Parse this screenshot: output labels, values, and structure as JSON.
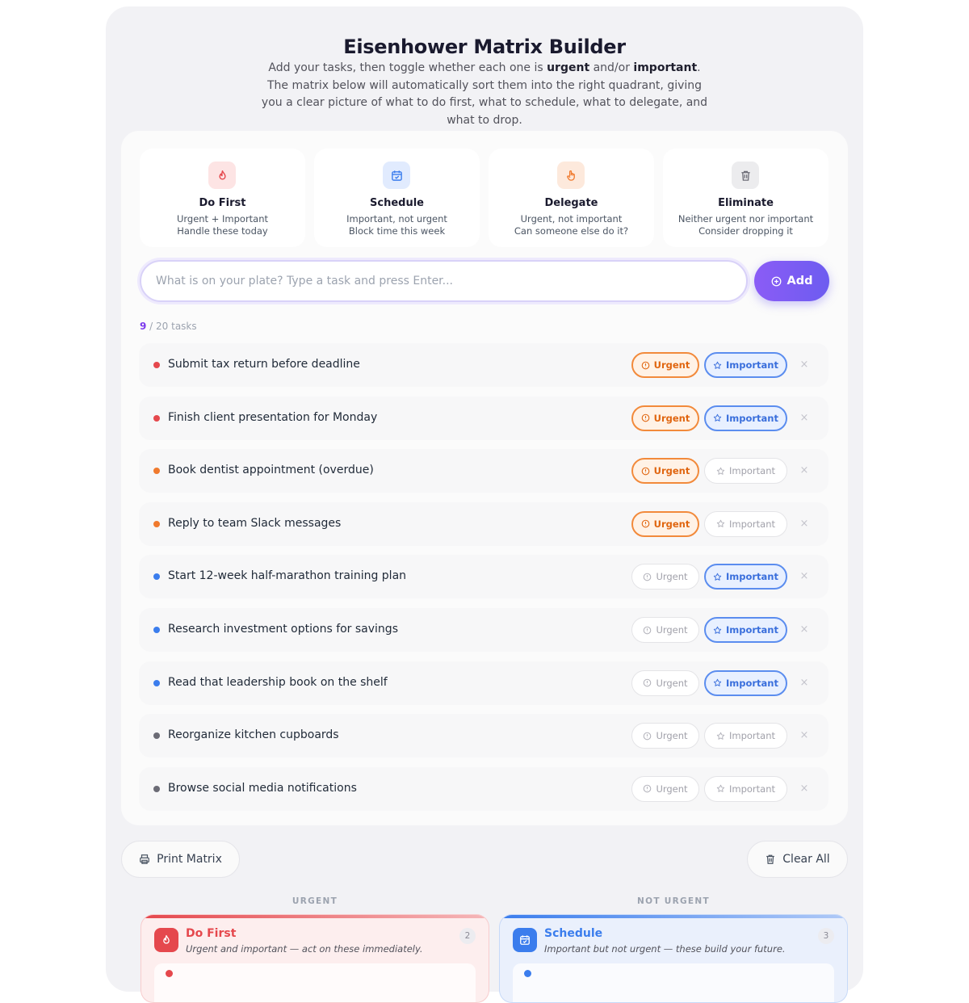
{
  "header": {
    "title": "Eisenhower Matrix Builder",
    "subtitle_part1": "Add your tasks, then toggle whether each one is ",
    "subtitle_urgent": "urgent",
    "subtitle_part2": " and/or ",
    "subtitle_important": "important",
    "subtitle_part3": ". The matrix below will automatically sort them into the right quadrant, giving you a clear picture of what to do first, what to schedule, what to delegate, and what to drop."
  },
  "legend": [
    {
      "name": "Do First",
      "line1": "Urgent + Important",
      "line2": "Handle these today",
      "icon": "flame-icon",
      "bg": "#fde4e4",
      "fg": "#e5484d"
    },
    {
      "name": "Schedule",
      "line1": "Important, not urgent",
      "line2": "Block time this week",
      "icon": "calendar-icon",
      "bg": "#e1ebfe",
      "fg": "#3b7ded"
    },
    {
      "name": "Delegate",
      "line1": "Urgent, not important",
      "line2": "Can someone else do it?",
      "icon": "hand-icon",
      "bg": "#fde9dc",
      "fg": "#f07a2e"
    },
    {
      "name": "Eliminate",
      "line1": "Neither urgent nor important",
      "line2": "Consider dropping it",
      "icon": "trash-icon",
      "bg": "#ececee",
      "fg": "#6b6b75"
    }
  ],
  "input": {
    "placeholder": "What is on your plate? Type a task and press Enter...",
    "value": ""
  },
  "add_button": {
    "label": "Add"
  },
  "task_count": {
    "current": "9",
    "suffix": " / 20 tasks"
  },
  "toggle_labels": {
    "urgent": "Urgent",
    "important": "Important",
    "remove": "×"
  },
  "tasks": [
    {
      "name": "Submit tax return before deadline",
      "urgent": true,
      "important": true
    },
    {
      "name": "Finish client presentation for Monday",
      "urgent": true,
      "important": true
    },
    {
      "name": "Book dentist appointment (overdue)",
      "urgent": true,
      "important": false
    },
    {
      "name": "Reply to team Slack messages",
      "urgent": true,
      "important": false
    },
    {
      "name": "Start 12-week half-marathon training plan",
      "urgent": false,
      "important": true
    },
    {
      "name": "Research investment options for savings",
      "urgent": false,
      "important": true
    },
    {
      "name": "Read that leadership book on the shelf",
      "urgent": false,
      "important": true
    },
    {
      "name": "Reorganize kitchen cupboards",
      "urgent": false,
      "important": false
    },
    {
      "name": "Browse social media notifications",
      "urgent": false,
      "important": false
    }
  ],
  "dot_colors": {
    "do_first": "#e5484d",
    "delegate": "#f07a2e",
    "schedule": "#3b7ded",
    "eliminate": "#6b6b75"
  },
  "footer_buttons": {
    "print": "Print Matrix",
    "clear": "Clear All"
  },
  "axes": {
    "urgent": "URGENT",
    "not_urgent": "NOT URGENT"
  },
  "quadrants": [
    {
      "name": "Do First",
      "desc": "Urgent and important — act on these immediately.",
      "count": "2",
      "icon": "flame-icon",
      "accent": "#e5484d",
      "bg": "#fdeeee"
    },
    {
      "name": "Schedule",
      "desc": "Important but not urgent — these build your future.",
      "count": "3",
      "icon": "calendar-icon",
      "accent": "#3b7ded",
      "bg": "#eaf0fc"
    }
  ]
}
